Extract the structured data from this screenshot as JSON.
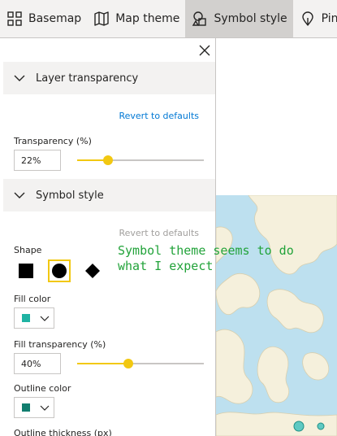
{
  "toolbar": {
    "tabs": [
      {
        "label": "Basemap"
      },
      {
        "label": "Map theme"
      },
      {
        "label": "Symbol style"
      },
      {
        "label": "Pins"
      }
    ]
  },
  "panel": {
    "layer_transparency": {
      "title": "Layer transparency",
      "revert_label": "Revert to defaults",
      "transparency_label": "Transparency (%)",
      "transparency_value": "22%",
      "slider_fraction": 0.22
    },
    "symbol_style": {
      "title": "Symbol style",
      "revert_label": "Revert to defaults",
      "shape_label": "Shape",
      "selected_shape": "circle",
      "fill_color_label": "Fill color",
      "fill_color": "#1fb3a3",
      "fill_transparency_label": "Fill transparency (%)",
      "fill_transparency_value": "40%",
      "fill_slider_fraction": 0.4,
      "outline_color_label": "Outline color",
      "outline_color": "#127e6f",
      "outline_thickness_label": "Outline thickness (px)"
    }
  },
  "annotation": {
    "line1": "Symbol theme seems to do",
    "line2": "what I expect"
  },
  "colors": {
    "accent": "#f2c811",
    "link": "#0078d4"
  }
}
